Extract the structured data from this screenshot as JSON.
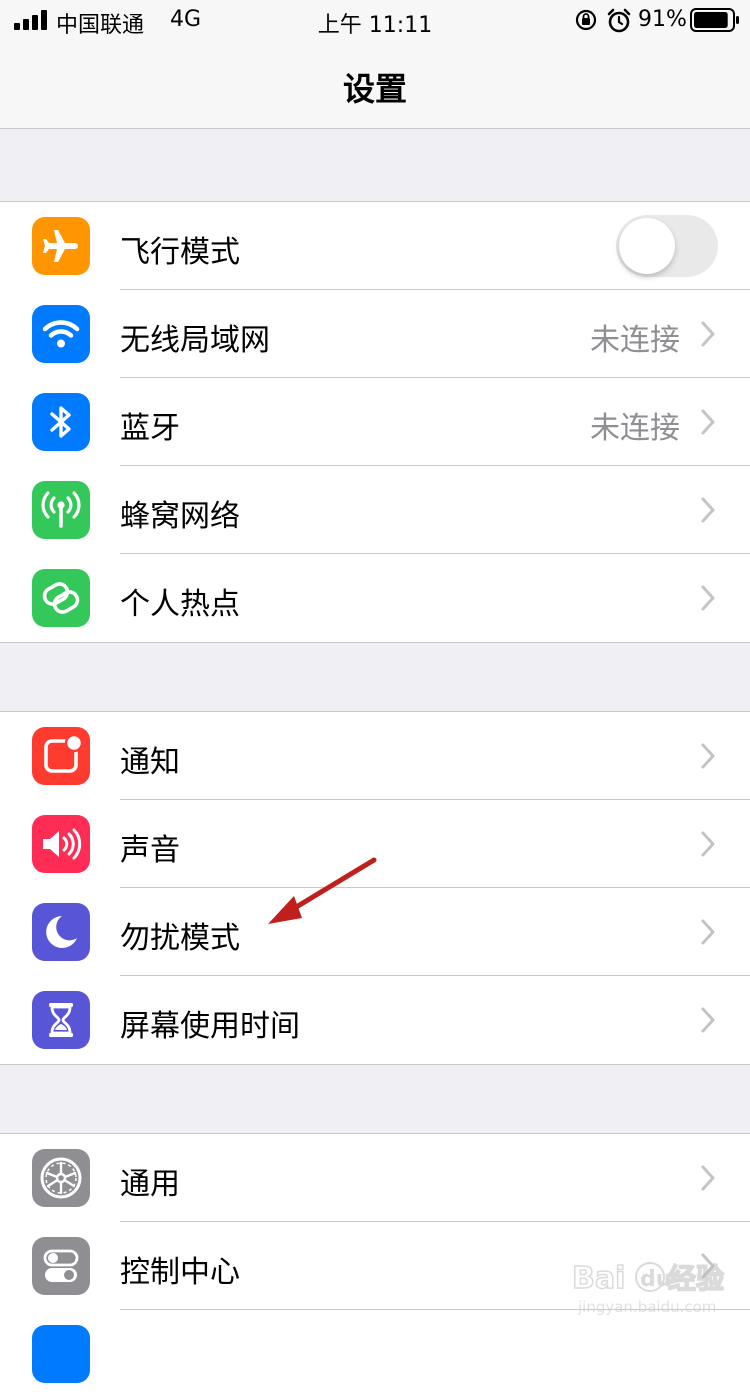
{
  "status_bar": {
    "carrier": "中国联通",
    "network": "4G",
    "time": "上午 11:11",
    "battery_percent": "91%",
    "battery_level": 0.91
  },
  "nav": {
    "title": "设置"
  },
  "groups": [
    {
      "rows": [
        {
          "label": "飞行模式",
          "icon": "airplane-icon",
          "color": "#ff9500",
          "toggle": false
        },
        {
          "label": "无线局域网",
          "icon": "wifi-icon",
          "color": "#007aff",
          "value": "未连接"
        },
        {
          "label": "蓝牙",
          "icon": "bluetooth-icon",
          "color": "#007aff",
          "value": "未连接"
        },
        {
          "label": "蜂窝网络",
          "icon": "cellular-antenna-icon",
          "color": "#34c759"
        },
        {
          "label": "个人热点",
          "icon": "hotspot-link-icon",
          "color": "#34c759"
        }
      ]
    },
    {
      "rows": [
        {
          "label": "通知",
          "icon": "notifications-icon",
          "color": "#ff3b30"
        },
        {
          "label": "声音",
          "icon": "speaker-icon",
          "color": "#ff2d55"
        },
        {
          "label": "勿扰模式",
          "icon": "moon-icon",
          "color": "#5856d6"
        },
        {
          "label": "屏幕使用时间",
          "icon": "hourglass-icon",
          "color": "#5856d6"
        }
      ]
    },
    {
      "rows": [
        {
          "label": "通用",
          "icon": "gear-icon",
          "color": "#8e8e93"
        },
        {
          "label": "控制中心",
          "icon": "switches-icon",
          "color": "#8e8e93"
        },
        {
          "label": "",
          "icon": "display-icon",
          "color": "#007aff"
        }
      ]
    }
  ],
  "watermark": {
    "brand": "Baidu经验",
    "url": "jingyan.baidu.com"
  },
  "annotation": {
    "color": "#c0201c"
  }
}
